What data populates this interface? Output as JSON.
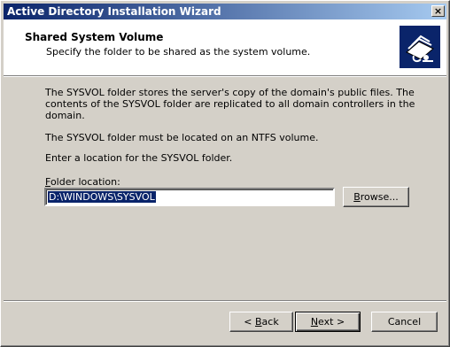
{
  "window": {
    "title": "Active Directory Installation Wizard",
    "close_label": "×"
  },
  "header": {
    "title": "Shared System Volume",
    "subtitle": "Specify the folder to be shared as the system volume.",
    "icon": "folder-share-icon"
  },
  "body": {
    "paragraph1": "The SYSVOL folder stores the server's copy of the domain's public files. The contents of the SYSVOL folder are replicated to all domain controllers in the domain.",
    "paragraph2": "The SYSVOL folder must be located on an NTFS volume.",
    "paragraph3": "Enter a location for the SYSVOL folder.",
    "folder_label_access": "F",
    "folder_label_rest": "older location:",
    "folder_value": "D:\\WINDOWS\\SYSVOL",
    "browse_access": "B",
    "browse_rest": "rowse..."
  },
  "footer": {
    "back_arrow": "< ",
    "back_access": "B",
    "back_rest": "ack",
    "next_access": "N",
    "next_rest": "ext >",
    "cancel_label": "Cancel"
  }
}
